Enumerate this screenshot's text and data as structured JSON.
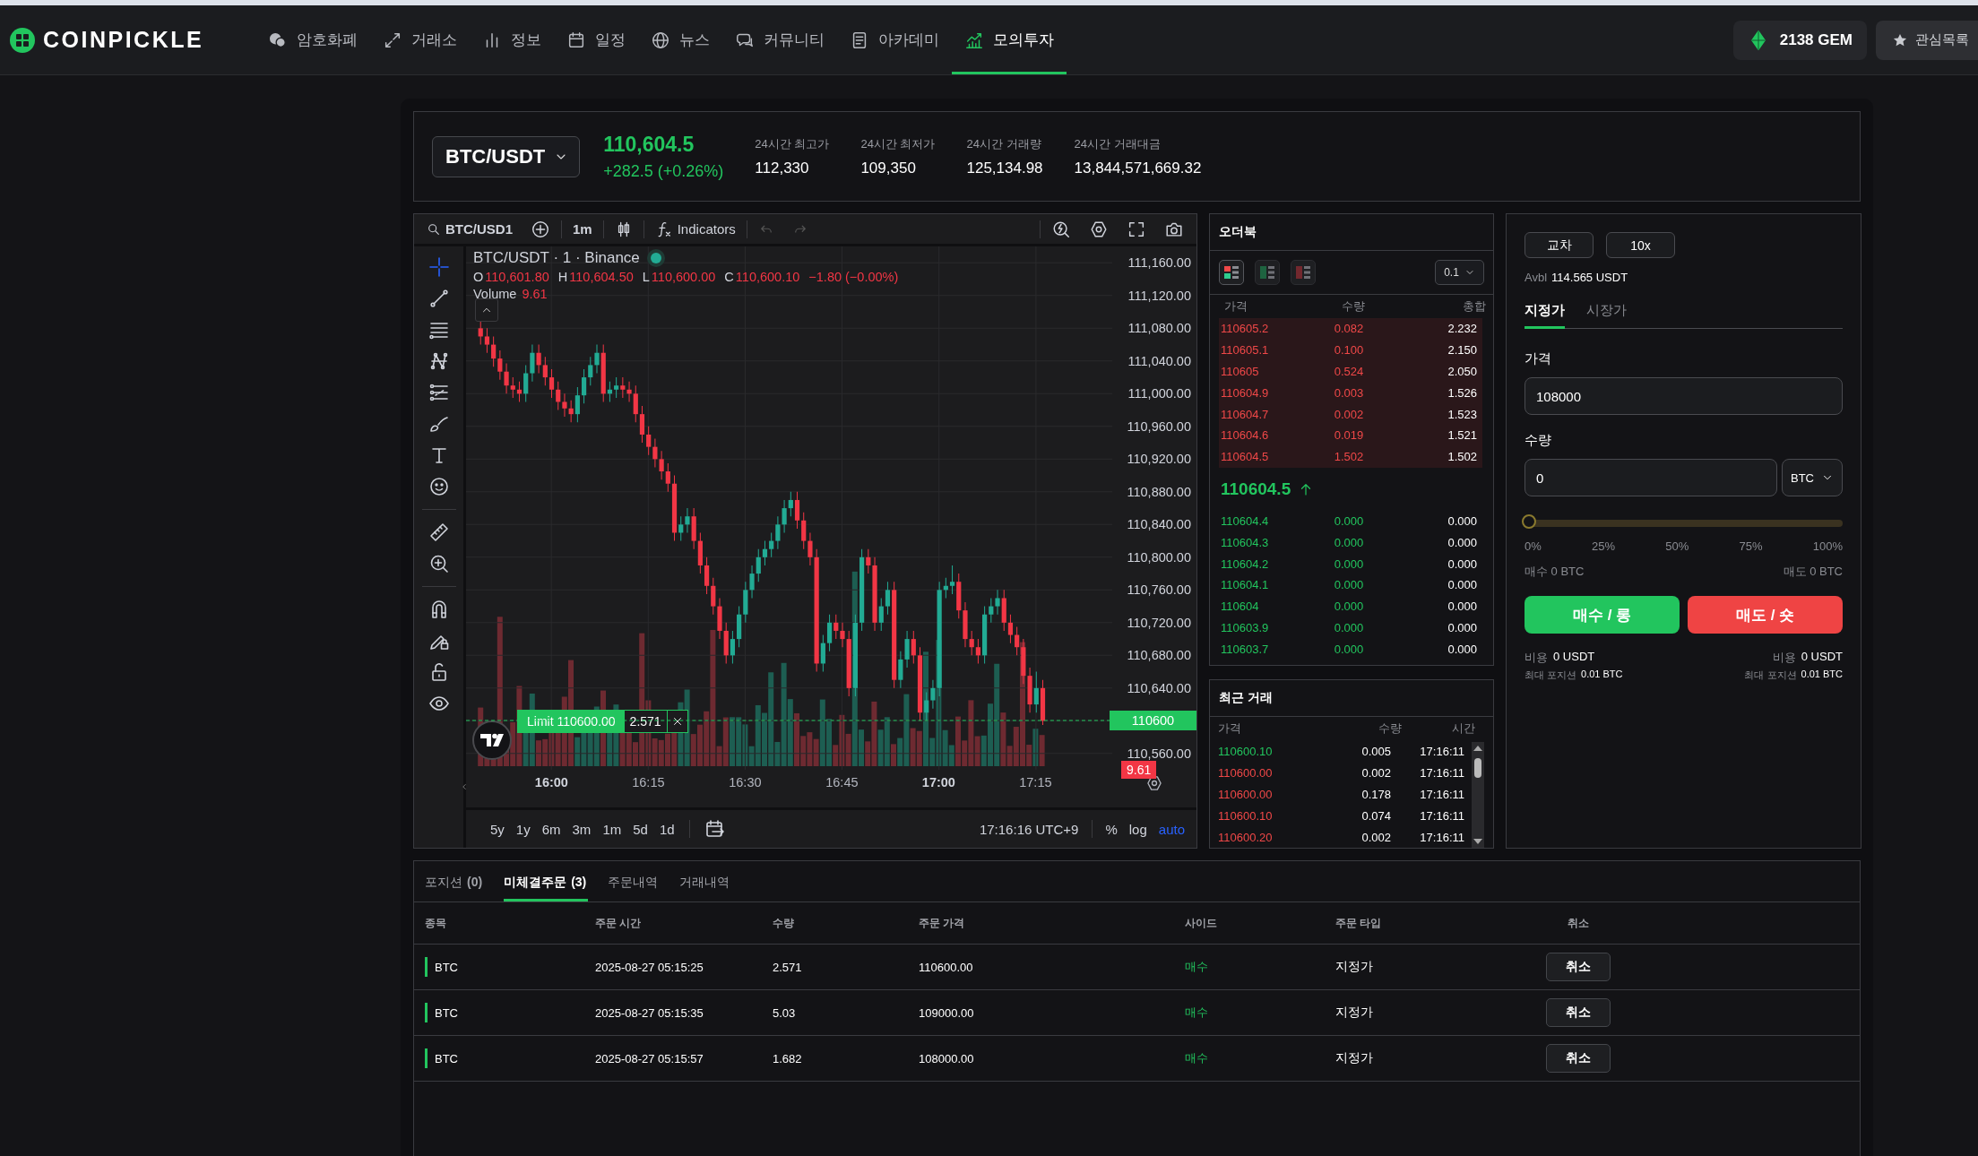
{
  "nav": {
    "logo": "COINPICKLE",
    "items": [
      {
        "label": "암호화폐",
        "kind": "coins",
        "selected": false
      },
      {
        "label": "거래소",
        "kind": "exchange",
        "selected": false
      },
      {
        "label": "정보",
        "kind": "info",
        "selected": false
      },
      {
        "label": "일정",
        "kind": "calendar",
        "selected": false
      },
      {
        "label": "뉴스",
        "kind": "news",
        "selected": false
      },
      {
        "label": "커뮤니티",
        "kind": "community",
        "selected": false
      },
      {
        "label": "아카데미",
        "kind": "academy",
        "selected": false
      },
      {
        "label": "모의투자",
        "kind": "trading",
        "selected": true
      }
    ],
    "gem": "2138 GEM",
    "watchlist": "관심목록"
  },
  "ticker": {
    "symbol": "BTC/USDT",
    "price": "110,604.5",
    "change": "+282.5 (+0.26%)",
    "stats": [
      {
        "label": "24시간 최고가",
        "value": "112,330"
      },
      {
        "label": "24시간 최저가",
        "value": "109,350"
      },
      {
        "label": "24시간 거래량",
        "value": "125,134.98"
      },
      {
        "label": "24시간 거래대금",
        "value": "13,844,571,669.32"
      }
    ]
  },
  "chart": {
    "symbol": "BTC/USD1",
    "interval": "1m",
    "indicators": "Indicators",
    "legend": {
      "title": "BTC/USDT · 1 · Binance",
      "live": true,
      "ohlc": [
        {
          "key": "O",
          "value": "110,601.80"
        },
        {
          "key": "H",
          "value": "110,604.50"
        },
        {
          "key": "L",
          "value": "110,600.00"
        },
        {
          "key": "C",
          "value": "110,600.10"
        }
      ],
      "change": "−1.80 (−0.00%)",
      "volume_label": "Volume",
      "volume_value": "9.61"
    },
    "order": {
      "label": "Limit 110600.00",
      "quantity": "2.571"
    },
    "price_tag": "110600",
    "volume_tag": "9.61",
    "ranges": [
      "5y",
      "1y",
      "6m",
      "3m",
      "1m",
      "5d",
      "1d"
    ],
    "clock": "17:16:16 UTC+9",
    "scales": [
      {
        "label": "%",
        "selected": false
      },
      {
        "label": "log",
        "selected": false
      },
      {
        "label": "auto",
        "selected": true
      }
    ],
    "chart_data": {
      "type": "candlestick",
      "yticks": [
        {
          "value": 111160,
          "label": "111,160.00"
        },
        {
          "value": 111120,
          "label": "111,120.00"
        },
        {
          "value": 111080,
          "label": "111,080.00"
        },
        {
          "value": 111040,
          "label": "111,040.00"
        },
        {
          "value": 111000,
          "label": "111,000.00"
        },
        {
          "value": 110960,
          "label": "110,960.00"
        },
        {
          "value": 110920,
          "label": "110,920.00"
        },
        {
          "value": 110880,
          "label": "110,880.00"
        },
        {
          "value": 110840,
          "label": "110,840.00"
        },
        {
          "value": 110800,
          "label": "110,800.00"
        },
        {
          "value": 110760,
          "label": "110,760.00"
        },
        {
          "value": 110720,
          "label": "110,720.00"
        },
        {
          "value": 110680,
          "label": "110,680.00"
        },
        {
          "value": 110640,
          "label": "110,640.00"
        },
        {
          "value": 110560,
          "label": "110,560.00"
        }
      ],
      "xticks": [
        {
          "value": 960,
          "label": "16:00"
        },
        {
          "value": 975,
          "label": "16:15"
        },
        {
          "value": 990,
          "label": "16:30"
        },
        {
          "value": 1005,
          "label": "16:45"
        },
        {
          "value": 1020,
          "label": "17:00"
        },
        {
          "value": 1035,
          "label": "17:15"
        }
      ],
      "xlim": [
        946.75,
        1046.75
      ],
      "ylim": [
        110540.1,
        111180.1
      ],
      "grid": true,
      "x": [
        949,
        950,
        951,
        952,
        953,
        954,
        955,
        956,
        957,
        958,
        959,
        960,
        961,
        962,
        963,
        964,
        965,
        966,
        967,
        968,
        969,
        970,
        971,
        972,
        973,
        974,
        975,
        976,
        977,
        978,
        979,
        980,
        981,
        982,
        983,
        984,
        985,
        986,
        987,
        988,
        989,
        990,
        991,
        992,
        993,
        994,
        995,
        996,
        997,
        998,
        999,
        1000,
        1001,
        1002,
        1003,
        1004,
        1005,
        1006,
        1007,
        1008,
        1009,
        1010,
        1011,
        1012,
        1013,
        1014,
        1015,
        1016,
        1017,
        1018,
        1019,
        1020,
        1021,
        1022,
        1023,
        1024,
        1025,
        1026,
        1027,
        1028,
        1029,
        1030,
        1031,
        1032,
        1033,
        1034,
        1035,
        1036
      ],
      "ohlc": [
        [
          111080,
          111090,
          111060,
          111070
        ],
        [
          111070,
          111080,
          111050,
          111060
        ],
        [
          111060,
          111070,
          111033,
          111043
        ],
        [
          111043,
          111053,
          111017,
          111027
        ],
        [
          111027,
          111037,
          111000,
          111010
        ],
        [
          111010,
          111020,
          110995,
          111005
        ],
        [
          111005,
          111015,
          110990,
          111000
        ],
        [
          111000,
          111035,
          110990,
          111025
        ],
        [
          111025,
          111060,
          111015,
          111050
        ],
        [
          111050,
          111060,
          111025,
          111035
        ],
        [
          111035,
          111045,
          111010,
          111020
        ],
        [
          111020,
          111030,
          110995,
          111005
        ],
        [
          111005,
          111015,
          110980,
          110990
        ],
        [
          110990,
          111000,
          110972,
          110982
        ],
        [
          110982,
          110992,
          110965,
          110975
        ],
        [
          110975,
          111008,
          110965,
          110998
        ],
        [
          110998,
          111030,
          110988,
          111020
        ],
        [
          111020,
          111045,
          111010,
          111035
        ],
        [
          111035,
          111060,
          111025,
          111050
        ],
        [
          111050,
          111060,
          110990,
          111000
        ],
        [
          111000,
          111015,
          110990,
          111005
        ],
        [
          111005,
          111020,
          110995,
          111010
        ],
        [
          111010,
          111020,
          110995,
          111005
        ],
        [
          111005,
          111015,
          110990,
          111000
        ],
        [
          111000,
          111010,
          110965,
          110975
        ],
        [
          110975,
          110985,
          110940,
          110950
        ],
        [
          110950,
          110960,
          110925,
          110935
        ],
        [
          110935,
          110945,
          110910,
          110920
        ],
        [
          110920,
          110930,
          110895,
          110905
        ],
        [
          110905,
          110915,
          110880,
          110890
        ],
        [
          110890,
          110900,
          110820,
          110830
        ],
        [
          110830,
          110850,
          110820,
          110840
        ],
        [
          110840,
          110860,
          110830,
          110850
        ],
        [
          110850,
          110860,
          110810,
          110820
        ],
        [
          110820,
          110830,
          110780,
          110790
        ],
        [
          110790,
          110800,
          110755,
          110765
        ],
        [
          110765,
          110775,
          110730,
          110740
        ],
        [
          110740,
          110750,
          110700,
          110710
        ],
        [
          110710,
          110720,
          110670,
          110680
        ],
        [
          110680,
          110710,
          110670,
          110700
        ],
        [
          110700,
          110740,
          110690,
          110730
        ],
        [
          110730,
          110770,
          110720,
          110760
        ],
        [
          110760,
          110790,
          110750,
          110780
        ],
        [
          110780,
          110810,
          110770,
          110800
        ],
        [
          110800,
          110820,
          110790,
          110810
        ],
        [
          110810,
          110830,
          110800,
          110820
        ],
        [
          110820,
          110850,
          110810,
          110840
        ],
        [
          110840,
          110870,
          110830,
          110860
        ],
        [
          110860,
          110880,
          110850,
          110870
        ],
        [
          110870,
          110880,
          110835,
          110845
        ],
        [
          110845,
          110855,
          110810,
          110820
        ],
        [
          110820,
          110830,
          110790,
          110800
        ],
        [
          110800,
          110810,
          110660,
          110670
        ],
        [
          110670,
          110705,
          110660,
          110695
        ],
        [
          110695,
          110730,
          110685,
          110720
        ],
        [
          110720,
          110730,
          110700,
          110710
        ],
        [
          110710,
          110720,
          110690,
          110700
        ],
        [
          110700,
          110710,
          110630,
          110640
        ],
        [
          110640,
          110730,
          110630,
          110720
        ],
        [
          110720,
          110810,
          110710,
          110800
        ],
        [
          110800,
          110810,
          110780,
          110790
        ],
        [
          110790,
          110800,
          110710,
          110720
        ],
        [
          110720,
          110750,
          110710,
          110740
        ],
        [
          110740,
          110770,
          110730,
          110760
        ],
        [
          110760,
          110770,
          110640,
          110650
        ],
        [
          110650,
          110685,
          110640,
          110675
        ],
        [
          110675,
          110710,
          110665,
          110700
        ],
        [
          110700,
          110710,
          110670,
          110680
        ],
        [
          110680,
          110690,
          110600,
          110610
        ],
        [
          110610,
          110635,
          110600,
          110625
        ],
        [
          110625,
          110650,
          110615,
          110640
        ],
        [
          110640,
          110770,
          110630,
          110760
        ],
        [
          110760,
          110775,
          110750,
          110765
        ],
        [
          110765,
          110790,
          110755,
          110770
        ],
        [
          110770,
          110780,
          110725,
          110735
        ],
        [
          110735,
          110745,
          110690,
          110700
        ],
        [
          110700,
          110710,
          110680,
          110690
        ],
        [
          110690,
          110700,
          110670,
          110680
        ],
        [
          110680,
          110740,
          110670,
          110730
        ],
        [
          110730,
          110750,
          110720,
          110740
        ],
        [
          110740,
          110760,
          110730,
          110750
        ],
        [
          110750,
          110760,
          110710,
          110720
        ],
        [
          110720,
          110730,
          110695,
          110705
        ],
        [
          110705,
          110715,
          110680,
          110690
        ],
        [
          110690,
          110700,
          110645,
          110655
        ],
        [
          110655,
          110665,
          110610,
          110620
        ],
        [
          110620,
          110660,
          110610,
          110640
        ],
        [
          110640,
          110650,
          110595,
          110600
        ]
      ]
    }
  },
  "orderbook": {
    "title": "오더북",
    "step": "0.1",
    "views": [
      {
        "kind": "both",
        "selected": true
      },
      {
        "kind": "bids",
        "selected": false
      },
      {
        "kind": "asks",
        "selected": false
      }
    ],
    "columns": [
      "가격",
      "수량",
      "총합"
    ],
    "asks": [
      [
        "110605.2",
        "0.082",
        "2.232"
      ],
      [
        "110605.1",
        "0.100",
        "2.150"
      ],
      [
        "110605",
        "0.524",
        "2.050"
      ],
      [
        "110604.9",
        "0.003",
        "1.526"
      ],
      [
        "110604.7",
        "0.002",
        "1.523"
      ],
      [
        "110604.6",
        "0.019",
        "1.521"
      ],
      [
        "110604.5",
        "1.502",
        "1.502"
      ]
    ],
    "last": "110604.5",
    "bids": [
      [
        "110604.4",
        "0.000",
        "0.000"
      ],
      [
        "110604.3",
        "0.000",
        "0.000"
      ],
      [
        "110604.2",
        "0.000",
        "0.000"
      ],
      [
        "110604.1",
        "0.000",
        "0.000"
      ],
      [
        "110604",
        "0.000",
        "0.000"
      ],
      [
        "110603.9",
        "0.000",
        "0.000"
      ],
      [
        "110603.7",
        "0.000",
        "0.000"
      ]
    ]
  },
  "trades": {
    "title": "최근 거래",
    "columns": [
      "가격",
      "수량",
      "시간"
    ],
    "rows": [
      {
        "price": "110600.10",
        "qty": "0.005",
        "time": "17:16:11",
        "color": "#22c55e"
      },
      {
        "price": "110600.00",
        "qty": "0.002",
        "time": "17:16:11",
        "color": "#f04848"
      },
      {
        "price": "110600.00",
        "qty": "0.178",
        "time": "17:16:11",
        "color": "#f04848"
      },
      {
        "price": "110600.10",
        "qty": "0.074",
        "time": "17:16:11",
        "color": "#f04848"
      },
      {
        "price": "110600.20",
        "qty": "0.002",
        "time": "17:16:11",
        "color": "#f04848"
      }
    ]
  },
  "order_form": {
    "margin": "교차",
    "leverage": "10x",
    "avbl_label": "Avbl",
    "avbl_value": "114.565 USDT",
    "tabs": [
      {
        "label": "지정가",
        "selected": true
      },
      {
        "label": "시장가",
        "selected": false
      }
    ],
    "price_label": "가격",
    "price_value": "108000",
    "qty_label": "수량",
    "qty_value": "0",
    "unit": "BTC",
    "slider": {
      "level": 0
    },
    "marks": [
      "0%",
      "25%",
      "50%",
      "75%",
      "100%"
    ],
    "buy_max": {
      "label": "매수",
      "value": "0 BTC"
    },
    "sell_max": {
      "label": "매도",
      "value": "0 BTC"
    },
    "buy_button": "매수 / 롱",
    "sell_button": "매도 / 숏",
    "buy_cost": {
      "label": "비용",
      "value": "0 USDT",
      "max_label": "최대 포지션",
      "max_value": "0.01 BTC"
    },
    "sell_cost": {
      "label": "비용",
      "value": "0 USDT",
      "max_label": "최대 포지션",
      "max_value": "0.01 BTC"
    }
  },
  "orders": {
    "tabs": [
      {
        "label": "포지션",
        "count": "(0)",
        "selected": false
      },
      {
        "label": "미체결주문",
        "count": "(3)",
        "selected": true
      },
      {
        "label": "주문내역",
        "selected": false
      },
      {
        "label": "거래내역",
        "selected": false
      }
    ],
    "columns": [
      "종목",
      "주문 시간",
      "수량",
      "주문 가격",
      "사이드",
      "주문 타입",
      "취소"
    ],
    "rows": [
      {
        "symbol": "BTC",
        "time": "2025-08-27 05:15:25",
        "qty": "2.571",
        "price": "110600.00",
        "side": "매수",
        "color": "#22c55e",
        "type": "지정가",
        "cancel": "취소"
      },
      {
        "symbol": "BTC",
        "time": "2025-08-27 05:15:35",
        "qty": "5.03",
        "price": "109000.00",
        "side": "매수",
        "color": "#22c55e",
        "type": "지정가",
        "cancel": "취소"
      },
      {
        "symbol": "BTC",
        "time": "2025-08-27 05:15:57",
        "qty": "1.682",
        "price": "108000.00",
        "side": "매수",
        "color": "#22c55e",
        "type": "지정가",
        "cancel": "취소"
      }
    ]
  }
}
